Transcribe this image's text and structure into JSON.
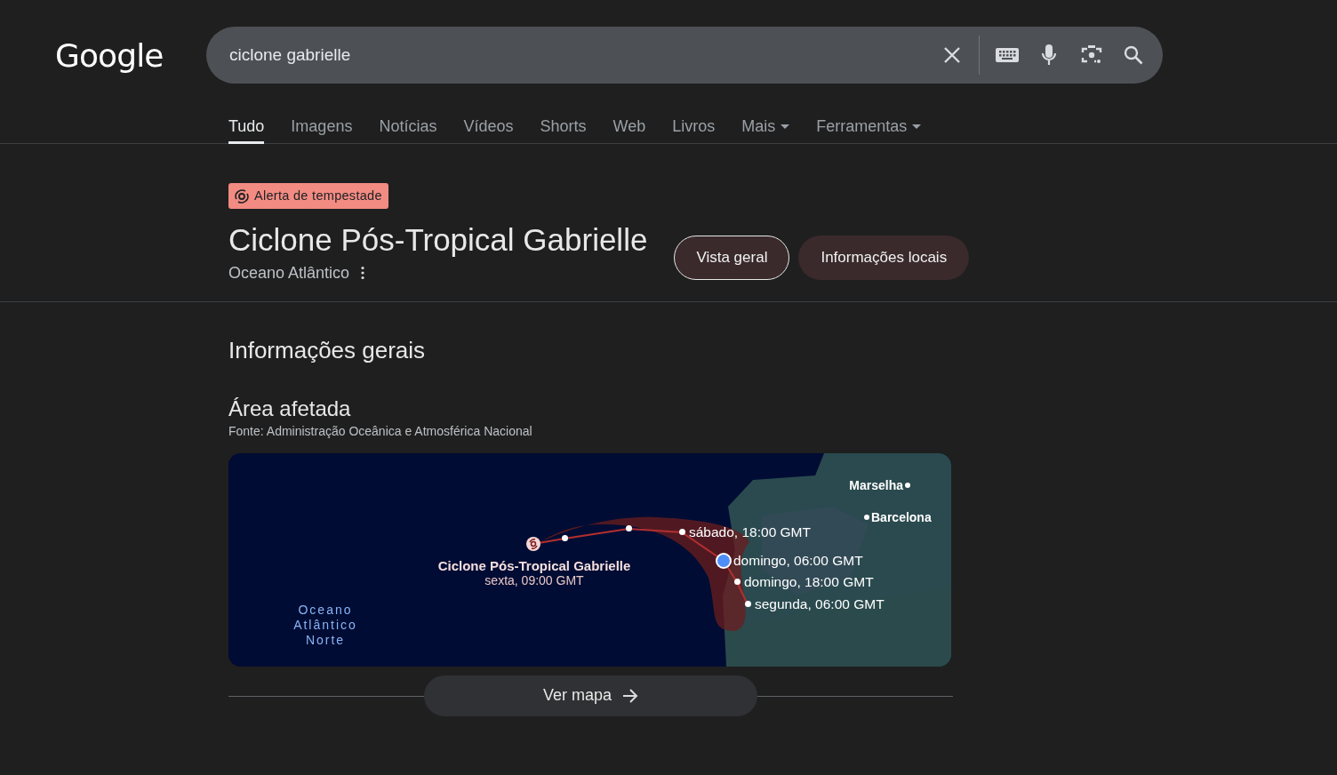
{
  "logo": "Google",
  "search": {
    "query": "ciclone gabrielle"
  },
  "tabs": [
    {
      "label": "Tudo",
      "selected": true,
      "dropdown": false
    },
    {
      "label": "Imagens",
      "selected": false,
      "dropdown": false
    },
    {
      "label": "Notícias",
      "selected": false,
      "dropdown": false
    },
    {
      "label": "Vídeos",
      "selected": false,
      "dropdown": false
    },
    {
      "label": "Shorts",
      "selected": false,
      "dropdown": false
    },
    {
      "label": "Web",
      "selected": false,
      "dropdown": false
    },
    {
      "label": "Livros",
      "selected": false,
      "dropdown": false
    },
    {
      "label": "Mais",
      "selected": false,
      "dropdown": true
    },
    {
      "label": "Ferramentas",
      "selected": false,
      "dropdown": true
    }
  ],
  "alert_badge": "Alerta de tempestade",
  "title": "Ciclone Pós-Tropical Gabrielle",
  "subtitle": "Oceano Atlântico",
  "views": [
    {
      "label": "Vista geral",
      "selected": true
    },
    {
      "label": "Informações locais",
      "selected": false
    }
  ],
  "section_title": "Informações gerais",
  "affected_area": {
    "title": "Área afetada",
    "source": "Fonte: Administração Oceânica e Atmosférica Nacional",
    "map": {
      "cities": [
        "Marselha",
        "Barcelona"
      ],
      "storm": {
        "name": "Ciclone Pós-Tropical Gabrielle",
        "time": "sexta, 09:00 GMT"
      },
      "forecast_points": [
        {
          "label": "sábado, 18:00 GMT",
          "current": false
        },
        {
          "label": "domingo, 06:00 GMT",
          "current": true
        },
        {
          "label": "domingo, 18:00 GMT",
          "current": false
        },
        {
          "label": "segunda, 06:00 GMT",
          "current": false
        }
      ],
      "ocean_label": "Oceano Atlântico Norte"
    },
    "map_button": "Ver mapa"
  }
}
